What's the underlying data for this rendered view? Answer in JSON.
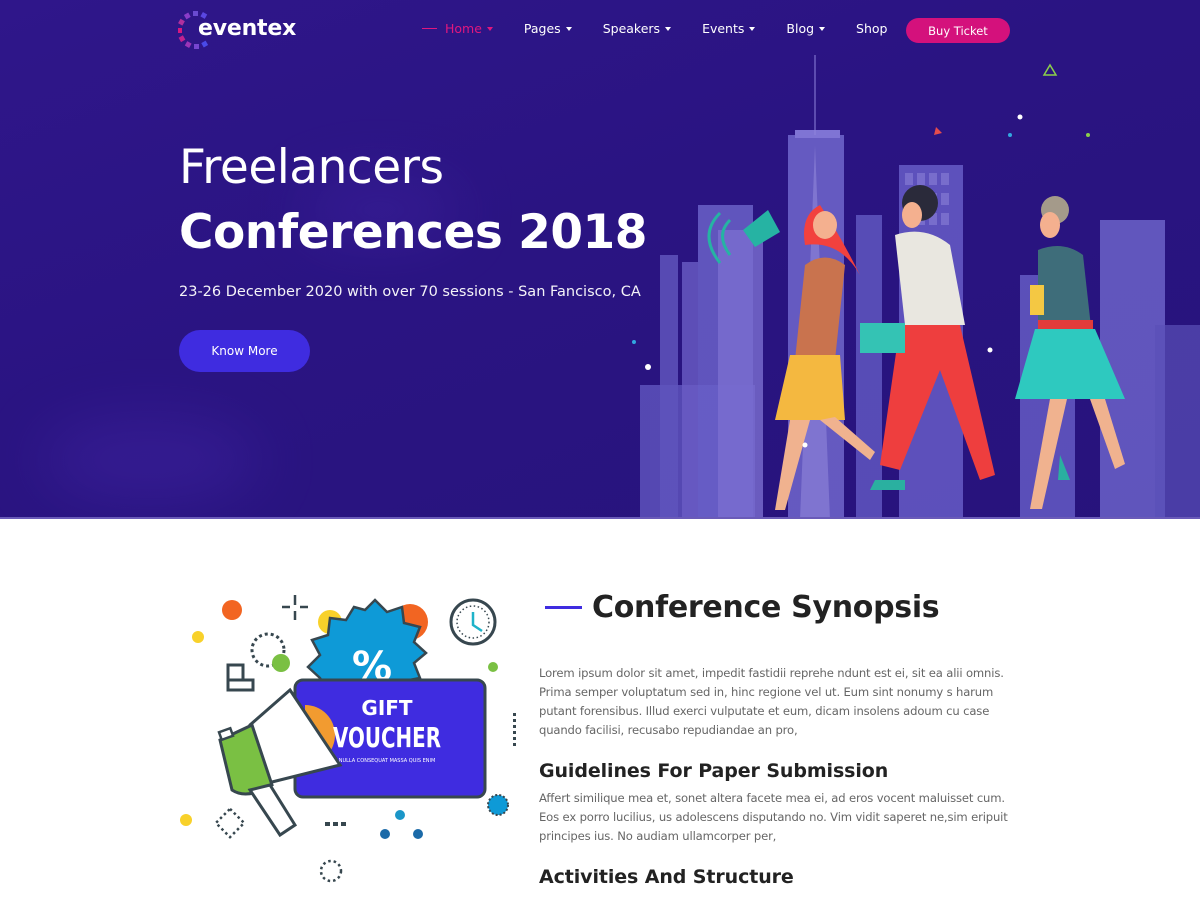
{
  "brand": {
    "name": "eventex",
    "colors": {
      "hero_bg": "#2a1482",
      "accent_pink": "#d4117c",
      "accent_blue": "#3f2ce0",
      "heading": "#222222",
      "body_text": "#666666"
    }
  },
  "nav": {
    "items": [
      {
        "label": "Home",
        "active": true,
        "dropdown": true
      },
      {
        "label": "Pages",
        "active": false,
        "dropdown": true
      },
      {
        "label": "Speakers",
        "active": false,
        "dropdown": true
      },
      {
        "label": "Events",
        "active": false,
        "dropdown": true
      },
      {
        "label": "Blog",
        "active": false,
        "dropdown": true
      },
      {
        "label": "Shop",
        "active": false,
        "dropdown": false
      }
    ],
    "cta_label": "Buy Ticket"
  },
  "hero": {
    "title_line1": "Freelancers",
    "title_line2": "Conferences 2018",
    "subtitle": "23-26 December 2020 with over 70 sessions - San Fancisco, CA",
    "button_label": "Know More",
    "illustration": "people-running-city-skyline"
  },
  "voucher": {
    "line1": "GIFT",
    "line2": "VOUCHER",
    "tagline": "NULLA CONSEQUAT MASSA QUIS ENIM",
    "percent_symbol": "%"
  },
  "synopsis": {
    "title": "Conference Synopsis",
    "intro": "Lorem ipsum dolor sit amet, impedit fastidii reprehe ndunt est ei, sit ea alii omnis. Prima semper voluptatum sed in, hinc regione vel ut. Eum sint nonumy s harum putant forensibus. Illud exerci vulputate et eum, dicam insolens adoum cu case quando facilisi, recusabo repudiandae an pro,",
    "sections": [
      {
        "title": "Guidelines For Paper Submission",
        "body": "Affert similique mea et, sonet altera facete mea ei, ad eros vocent maluisset cum. Eos ex porro lucilius, us adolescens disputando no. Vim vidit saperet ne,sim eripuit principes ius. No audiam ullamcorper per,"
      },
      {
        "title": "Activities And Structure",
        "body": ""
      }
    ]
  }
}
